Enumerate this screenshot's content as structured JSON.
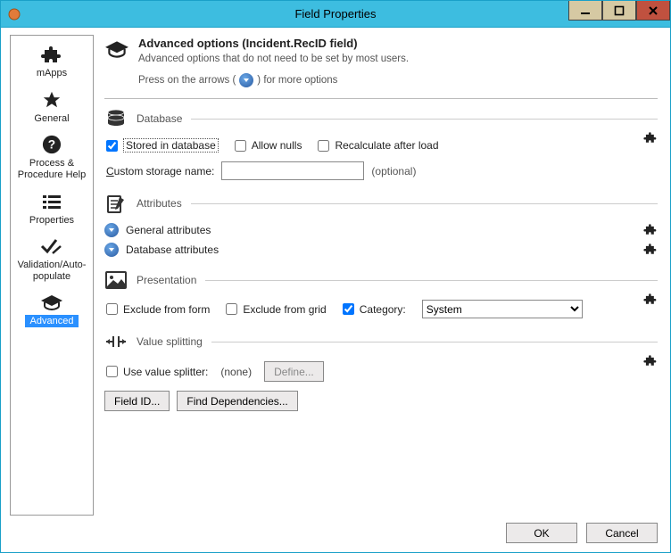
{
  "window": {
    "title": "Field Properties"
  },
  "sidebar": {
    "items": [
      {
        "label": "mApps"
      },
      {
        "label": "General"
      },
      {
        "label": "Process & Procedure Help"
      },
      {
        "label": "Properties"
      },
      {
        "label": "Validation/Auto-populate"
      },
      {
        "label": "Advanced",
        "selected": true
      }
    ]
  },
  "header": {
    "title": "Advanced options (Incident.RecID field)",
    "subtitle": "Advanced options that do not need to be set by most users.",
    "hint_before": "Press on the arrows (",
    "hint_after": ") for more options"
  },
  "database": {
    "title": "Database",
    "stored_label": "Stored in database",
    "stored_checked": true,
    "allow_nulls_label": "Allow nulls",
    "allow_nulls_checked": false,
    "recalc_label": "Recalculate after load",
    "recalc_checked": false,
    "custom_storage_label_pre": "C",
    "custom_storage_label_post": "ustom storage name:",
    "custom_storage_value": "",
    "optional": "(optional)"
  },
  "attributes": {
    "title": "Attributes",
    "general": "General attributes",
    "database": "Database attributes"
  },
  "presentation": {
    "title": "Presentation",
    "exclude_form_label": "Exclude from form",
    "exclude_form_checked": false,
    "exclude_grid_label": "Exclude from grid",
    "exclude_grid_checked": false,
    "category_label": "Category:",
    "category_checked": true,
    "category_value": "System"
  },
  "value_splitting": {
    "title": "Value splitting",
    "use_splitter_label": "Use value splitter:",
    "use_splitter_checked": false,
    "splitter_value": "(none)",
    "define_btn": "Define...",
    "field_id_btn": "Field ID...",
    "find_deps_btn": "Find Dependencies..."
  },
  "footer": {
    "ok": "OK",
    "cancel": "Cancel"
  }
}
